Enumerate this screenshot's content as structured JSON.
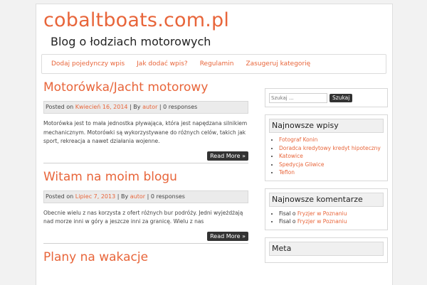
{
  "site": {
    "title": "cobaltboats.com.pl",
    "description": "Blog o łodziach motorowych"
  },
  "nav": [
    {
      "label": "Dodaj pojedynczy wpis"
    },
    {
      "label": "Jak dodać wpis?"
    },
    {
      "label": "Regulamin"
    },
    {
      "label": "Zasugeruj kategorię"
    }
  ],
  "posts": [
    {
      "title": "Motorówka/Jacht motorowy",
      "posted_on": "Posted on",
      "date": "Kwiecień 16, 2014",
      "by": "| By",
      "author": "autor",
      "responses": "| 0 responses",
      "excerpt": "Motorówka jest to mała jednostka pływająca, która jest napędzana silnikiem mechanicznym. Motorówki są wykorzystywane do różnych celów, takich jak sport, rekreacja a nawet działania wojenne.",
      "read_more": "Read More »"
    },
    {
      "title": "Witam na moim blogu",
      "posted_on": "Posted on",
      "date": "Lipiec 7, 2013",
      "by": "| By",
      "author": "autor",
      "responses": "| 0 responses",
      "excerpt": "Obecnie wielu z nas korzysta z ofert różnych bur podróży. Jedni wyjeżdżają nad morze inni w góry a jeszcze inni za granicę. Wielu z nas",
      "read_more": "Read More »"
    },
    {
      "title": "Plany na wakacje"
    }
  ],
  "search": {
    "placeholder": "Szukaj ...",
    "button": "Szukaj"
  },
  "widgets": {
    "recent_posts": {
      "title": "Najnowsze wpisy",
      "items": [
        "Fotograf Konin",
        "Doradca kredytowy kredyt hipoteczny",
        "Katowice",
        "Spedycja Gliwice",
        "Teflon"
      ]
    },
    "recent_comments": {
      "title": "Najnowsze komentarze",
      "items": [
        {
          "author": "Fisal",
          "on": "o",
          "post": "Fryzjer w Poznaniu"
        },
        {
          "author": "Fisal",
          "on": "o",
          "post": "Fryzjer w Poznaniu"
        }
      ]
    },
    "meta": {
      "title": "Meta"
    }
  },
  "colors": {
    "accent": "#e8653a",
    "button": "#333333",
    "meta_bg": "#ebebeb"
  }
}
